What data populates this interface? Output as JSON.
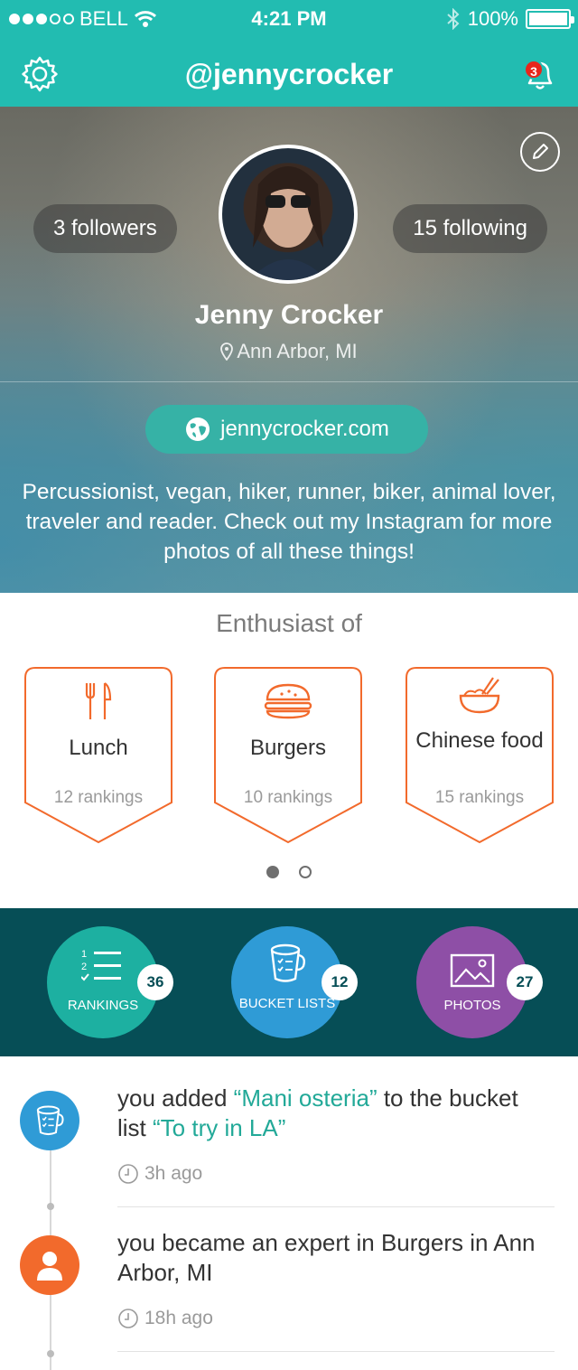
{
  "status_bar": {
    "carrier": "BELL",
    "time": "4:21 PM",
    "battery": "100%"
  },
  "nav": {
    "title": "@jennycrocker",
    "notification_count": "3",
    "icons": [
      "gear-icon",
      "bell-icon"
    ]
  },
  "profile": {
    "followers": "3 followers",
    "following": "15 following",
    "name": "Jenny Crocker",
    "location": "Ann Arbor, MI",
    "website": "jennycrocker.com",
    "bio": "Percussionist, vegan, hiker, runner, biker, animal lover, traveler and reader. Check out my Instagram for more photos of all these things!"
  },
  "enthusiast": {
    "title": "Enthusiast of",
    "cards": [
      {
        "label": "Lunch",
        "count": "12 rankings",
        "icon": "fork-knife-icon"
      },
      {
        "label": "Burgers",
        "count": "10 rankings",
        "icon": "burger-icon"
      },
      {
        "label": "Chinese food",
        "count": "15 rankings",
        "icon": "noodle-bowl-icon"
      }
    ],
    "page": 1,
    "page_count": 2
  },
  "stats": [
    {
      "label": "RANKINGS",
      "count": "36",
      "color": "#1db0a1",
      "icon": "list-icon"
    },
    {
      "label": "BUCKET LISTS",
      "count": "12",
      "color": "#2f9bd6",
      "icon": "bucket-icon"
    },
    {
      "label": "PHOTOS",
      "count": "27",
      "color": "#8e4fa6",
      "icon": "image-icon"
    }
  ],
  "feed": [
    {
      "text_prefix": "you added ",
      "highlight_1": "“Mani osteria”",
      "text_middle": " to the bucket list ",
      "highlight_2": "“To try in LA”",
      "time": "3h ago",
      "icon": "bucket-icon",
      "icon_color": "#2f9bd6"
    },
    {
      "text": "you became an expert in Burgers in Ann Arbor, MI",
      "time": "18h ago",
      "icon": "user-icon",
      "icon_color": "#f26a2c"
    }
  ],
  "colors": {
    "brand": "#22bcb1",
    "accent_orange": "#f26a2c",
    "band": "#064e56"
  }
}
